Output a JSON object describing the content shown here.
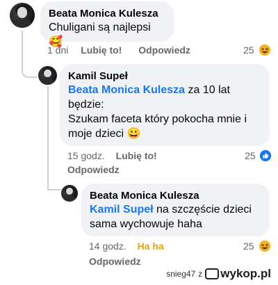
{
  "comments": [
    {
      "author": "Beata Monica Kulesza",
      "mention": "",
      "text": "Chuligani są najlepsi",
      "emoji": "🥰",
      "time": "1 dni",
      "like_label": "Lubię to!",
      "reply_label": "Odpowiedz",
      "reaction_count": "25",
      "reaction_icon": "laughing-reaction-icon"
    },
    {
      "author": "Kamil Supeł",
      "mention": "Beata Monica Kulesza",
      "text_line1": " za 10 lat",
      "text_line2": "będzie:",
      "text_line3": "Szukam faceta który pokocha mnie i",
      "text_line4": "moje dzieci",
      "emoji": "😀",
      "time": "15 godz.",
      "like_label": "Lubię to!",
      "reply_label": "Odpowiedz",
      "reaction_count": "25",
      "reaction_icon": "like-reaction-icon"
    },
    {
      "author": "Beata Monica Kulesza",
      "mention": "Kamil Supeł",
      "text_line1": " na szczęście dzieci",
      "text_line2": "sama wychowuje haha",
      "time": "14 godz.",
      "like_label": "Ha ha",
      "reply_label": "Odpowiedz",
      "reaction_count": "25",
      "reaction_icon": "laughing-reaction-icon"
    }
  ],
  "footer": {
    "user": "snieg47",
    "separator": "z",
    "site": "wykop.pl"
  },
  "colors": {
    "mention": "#1877f2",
    "haha_active": "#e4a50f",
    "bubble": "#f0f2f5"
  }
}
